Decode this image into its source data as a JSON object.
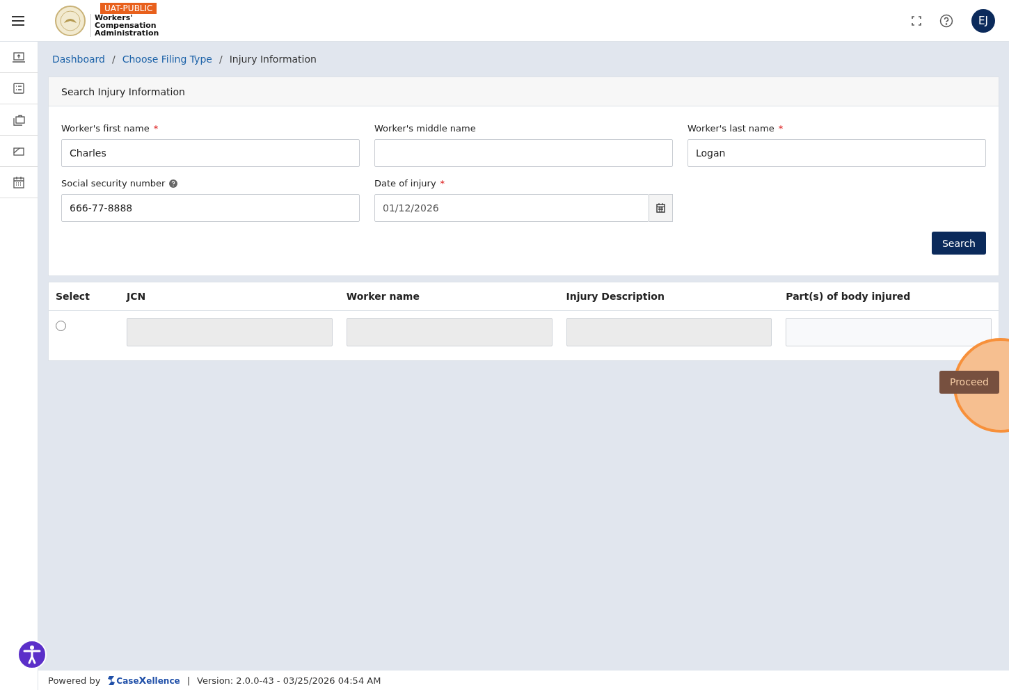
{
  "header": {
    "env_badge": "UAT-PUBLIC",
    "agency_name": [
      "Workers'",
      "Compensation",
      "Administration"
    ],
    "avatar_initials": "EJ"
  },
  "breadcrumb": [
    {
      "label": "Dashboard",
      "current": false
    },
    {
      "separator_before": "/",
      "label": "Choose Filing Type",
      "current": false
    },
    {
      "separator_before": "/",
      "label": "Injury Information",
      "current": true
    }
  ],
  "search_card": {
    "title": "Search Injury Information",
    "fields": [
      {
        "kind": "text",
        "label": "Worker's first name",
        "required_marker": "*",
        "value": "Charles"
      },
      {
        "kind": "text",
        "label": "Worker's middle name"
      },
      {
        "kind": "text",
        "label": "Worker's last name",
        "required_marker": "*",
        "value": "Logan"
      },
      {
        "kind": "help",
        "label": "Social security number",
        "value": "666-77-8888"
      },
      {
        "kind": "date",
        "label": "Date of injury",
        "required_marker": "*",
        "value": "01/12/2026"
      }
    ],
    "search_button": "Search"
  },
  "results_table": {
    "columns": [
      "Select",
      "JCN",
      "Worker name",
      "Injury Description",
      "Part(s) of body injured"
    ],
    "rows": [
      {
        "selected": false,
        "cells": [
          {
            "disabled": true
          },
          {
            "disabled": true
          },
          {
            "disabled": true
          },
          {
            "disabled": false
          }
        ]
      }
    ]
  },
  "proceed_button": "Proceed",
  "click_highlight": true,
  "footer": {
    "powered_by": "Powered by",
    "brand_prefix": "Case",
    "brand_x": "X",
    "brand_suffix": "ellence",
    "separator": "|",
    "version": "Version: 2.0.0-43 - 03/25/2026 04:54 AM"
  }
}
